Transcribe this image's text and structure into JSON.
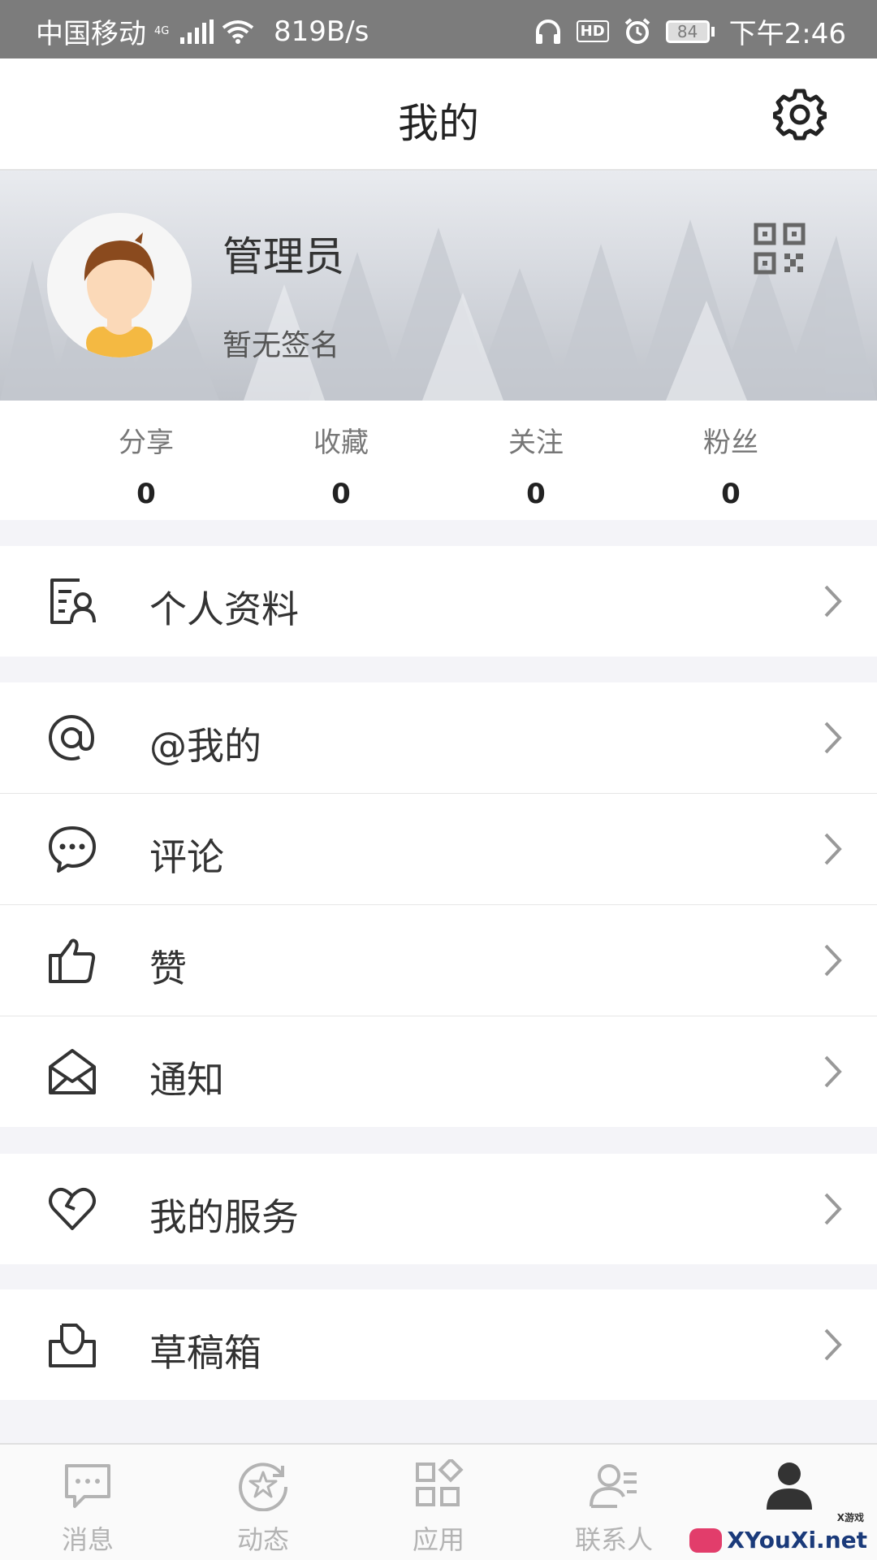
{
  "status": {
    "carrier": "中国移动",
    "net": "4G",
    "speed": "819B/s",
    "hd": "HD",
    "battery": "84",
    "time": "下午2:46"
  },
  "header": {
    "title": "我的"
  },
  "profile": {
    "name": "管理员",
    "signature": "暂无签名"
  },
  "stats": [
    {
      "label": "分享",
      "value": "0"
    },
    {
      "label": "收藏",
      "value": "0"
    },
    {
      "label": "关注",
      "value": "0"
    },
    {
      "label": "粉丝",
      "value": "0"
    }
  ],
  "menu": {
    "profile_info": "个人资料",
    "at_me": "@我的",
    "comments": "评论",
    "likes": "赞",
    "notifications": "通知",
    "my_services": "我的服务",
    "drafts": "草稿箱"
  },
  "tabs": [
    {
      "label": "消息",
      "icon": "chat-icon"
    },
    {
      "label": "动态",
      "icon": "moments-icon"
    },
    {
      "label": "应用",
      "icon": "apps-icon"
    },
    {
      "label": "联系人",
      "icon": "contacts-icon"
    },
    {
      "label": "",
      "icon": "me-icon",
      "active": true
    }
  ],
  "watermark": {
    "text": "XYouXi.net",
    "small": "X游戏"
  },
  "colors": {
    "banner": "#d6d9df",
    "tab_inactive": "#b3b3b3",
    "tab_active": "#333333"
  }
}
